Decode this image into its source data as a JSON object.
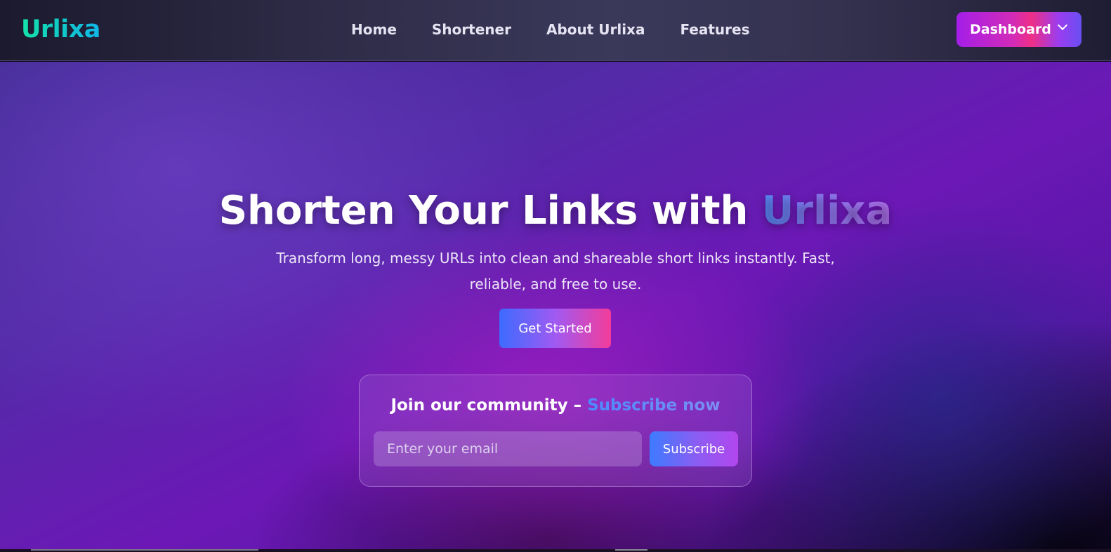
{
  "navbar": {
    "logo": "Urlixa",
    "links": [
      "Home",
      "Shortener",
      "About Urlixa",
      "Features"
    ],
    "dashboard_label": "Dashboard"
  },
  "hero": {
    "title_main": "Shorten Your Links with ",
    "title_accent": "Urlixa",
    "subtitle": "Transform long, messy URLs into clean and shareable short links instantly. Fast, reliable, and free to use.",
    "cta_label": "Get Started"
  },
  "subscribe": {
    "title_main": "Join our community – ",
    "title_link": "Subscribe now",
    "email_placeholder": "Enter your email",
    "button_label": "Subscribe"
  },
  "icons": {
    "dropdown": "chevron-down-icon"
  },
  "colors": {
    "logo_gradient_start": "#14e3a9",
    "logo_gradient_end": "#11b8e8",
    "accent_blue": "#5a8cff",
    "accent_purple": "#b574f5",
    "cta_pink": "#f33c9a"
  }
}
